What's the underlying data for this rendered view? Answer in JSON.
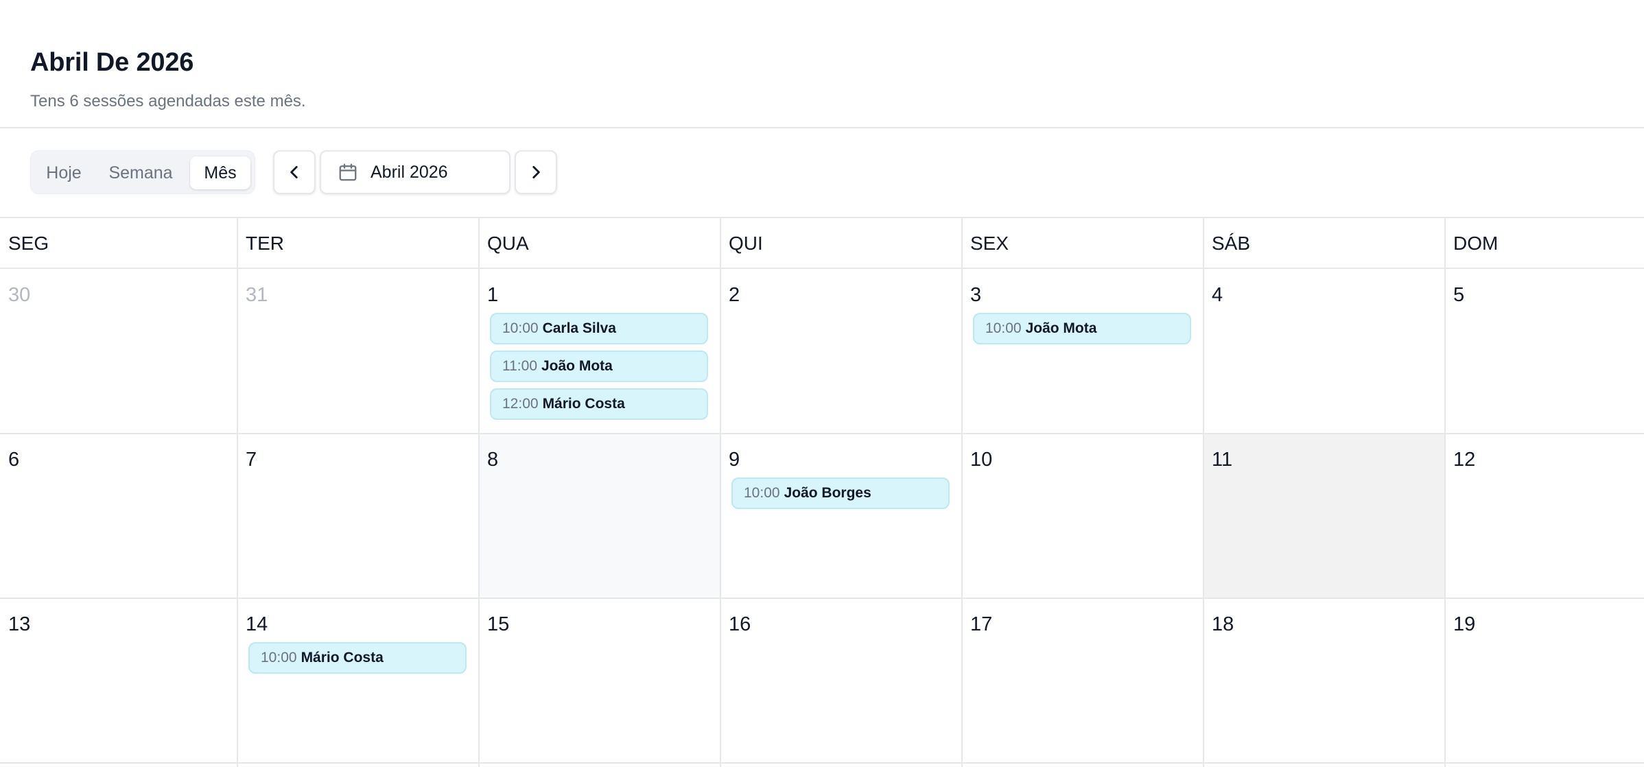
{
  "header": {
    "title": "Abril De 2026",
    "subtitle": "Tens 6 sessões agendadas este mês."
  },
  "toolbar": {
    "views": [
      "Hoje",
      "Semana",
      "Mês"
    ],
    "active_view": "Mês",
    "month_label": "Abril 2026",
    "prev_icon": "chevron-left-icon",
    "next_icon": "chevron-right-icon",
    "calendar_icon": "calendar-icon"
  },
  "weekdays": [
    "SEG",
    "TER",
    "QUA",
    "QUI",
    "SEX",
    "SÁB",
    "DOM"
  ],
  "weeks": [
    [
      {
        "day": "30",
        "muted": true
      },
      {
        "day": "31",
        "muted": true
      },
      {
        "day": "1",
        "events": [
          {
            "time": "10:00",
            "name": "Carla Silva"
          },
          {
            "time": "11:00",
            "name": "João Mota"
          },
          {
            "time": "12:00",
            "name": "Mário Costa"
          }
        ]
      },
      {
        "day": "2"
      },
      {
        "day": "3",
        "events": [
          {
            "time": "10:00",
            "name": "João Mota"
          }
        ]
      },
      {
        "day": "4"
      },
      {
        "day": "5"
      }
    ],
    [
      {
        "day": "6"
      },
      {
        "day": "7"
      },
      {
        "day": "8",
        "shade": "light"
      },
      {
        "day": "9",
        "events": [
          {
            "time": "10:00",
            "name": "João Borges"
          }
        ]
      },
      {
        "day": "10"
      },
      {
        "day": "11",
        "shade": "grey"
      },
      {
        "day": "12"
      }
    ],
    [
      {
        "day": "13"
      },
      {
        "day": "14",
        "events": [
          {
            "time": "10:00",
            "name": "Mário Costa"
          }
        ]
      },
      {
        "day": "15"
      },
      {
        "day": "16"
      },
      {
        "day": "17"
      },
      {
        "day": "18"
      },
      {
        "day": "19"
      }
    ]
  ],
  "colors": {
    "event_bg": "#d8f5fb",
    "event_border": "#bfe8f2",
    "grid_line": "#e5e7eb"
  }
}
